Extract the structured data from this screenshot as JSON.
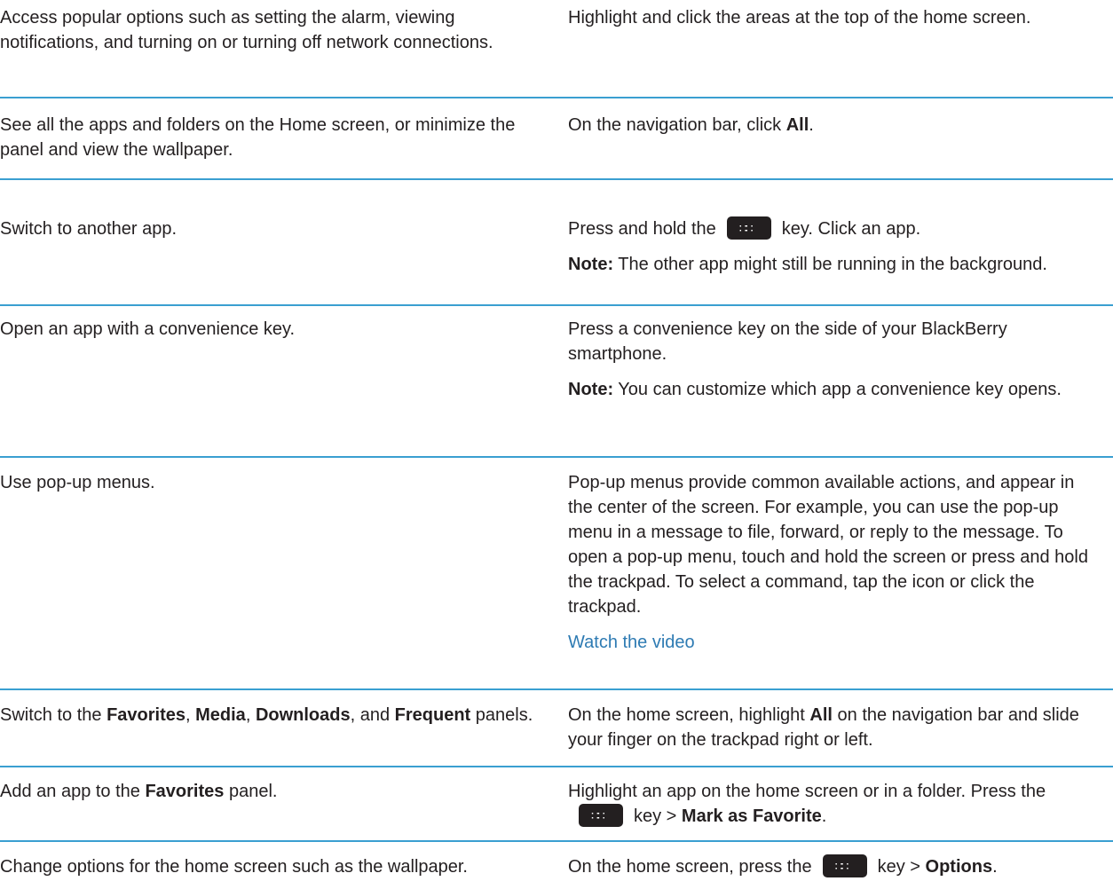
{
  "rows": [
    {
      "task": "Access popular options such as setting the alarm, viewing notifications, and turning on or turning off network connections.",
      "action": "Highlight and click the areas at the top of the home screen."
    },
    {
      "task": "See all the apps and folders on the Home screen, or minimize the panel and view the wallpaper.",
      "action_pre": "On the navigation bar, click ",
      "action_bold": "All",
      "action_post": "."
    },
    {
      "task": "Switch to another app.",
      "action_pre": "Press and hold the",
      "action_post": "key. Click an app.",
      "note_label": "Note:",
      "note_text": " The other app might still be running in the background."
    },
    {
      "task": "Open an app with a convenience key.",
      "action": "Press a convenience key on the side of your BlackBerry smartphone.",
      "note_label": "Note:",
      "note_text": " You can customize which app a convenience key opens."
    },
    {
      "task": "Use pop-up menus.",
      "action": "Pop-up menus provide common available actions, and appear in the center of the screen. For example, you can use the pop-up menu in a message to file, forward, or reply to the message. To open a pop-up menu, touch and hold the screen or press and hold the trackpad. To select a command, tap the icon or click the trackpad.",
      "link": "Watch the video"
    },
    {
      "task_pre": "Switch to the ",
      "task_b1": "Favorites",
      "task_s1": ", ",
      "task_b2": "Media",
      "task_s2": ", ",
      "task_b3": "Downloads",
      "task_s3": ", and ",
      "task_b4": "Frequent",
      "task_post": " panels.",
      "action_pre": "On the home screen, highlight ",
      "action_bold": "All",
      "action_post": " on the navigation bar and slide your finger on the trackpad right or left."
    },
    {
      "task_pre": "Add an app to the ",
      "task_bold": "Favorites",
      "task_post": " panel.",
      "action_pre": "Highlight an app on the home screen or in a folder. Press the",
      "action_mid": "key > ",
      "action_bold": "Mark as Favorite",
      "action_post": "."
    },
    {
      "task": "Change options for the home screen such as the wallpaper.",
      "action_pre": "On the home screen, press the",
      "action_mid": "key > ",
      "action_bold": "Options",
      "action_post": "."
    }
  ]
}
